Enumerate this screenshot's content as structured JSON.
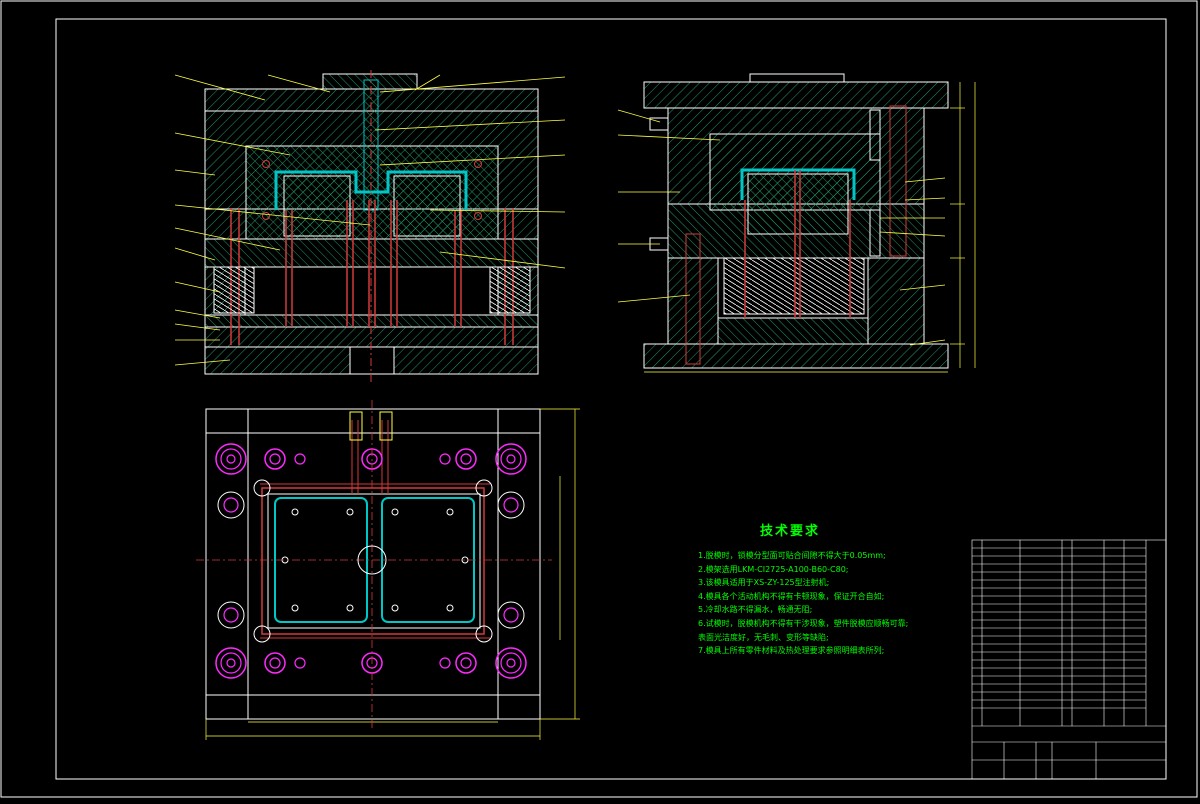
{
  "drawing": {
    "colors": {
      "background": "#000000",
      "outline": "#ffffff",
      "hatch": "#1e9a66",
      "cavity": "#00c6c6",
      "pins": "#d43a3a",
      "leaders": "#ffff40",
      "magenta": "#ff2aff",
      "text": "#00ff00"
    },
    "technical_requirements": {
      "title": "技术要求",
      "lines": [
        "1.脱模时，锁模分型面可贴合间隙不得大于0.05mm;",
        "2.模架选用LKM-CI2725-A100-B60-C80;",
        "3.该模具适用于XS-ZY-125型注射机;",
        "4.模具各个活动机构不得有卡顿现象，保证开合自如;",
        "5.冷却水路不得漏水，畅通无阻;",
        "6.试模时，脱模机构不得有干涉现象，塑件脱模应顺畅可靠;",
        "  表面光洁度好，无毛刺、变形等缺陷;",
        "7.模具上所有零件材料及热处理要求参照明细表所列;"
      ]
    }
  }
}
